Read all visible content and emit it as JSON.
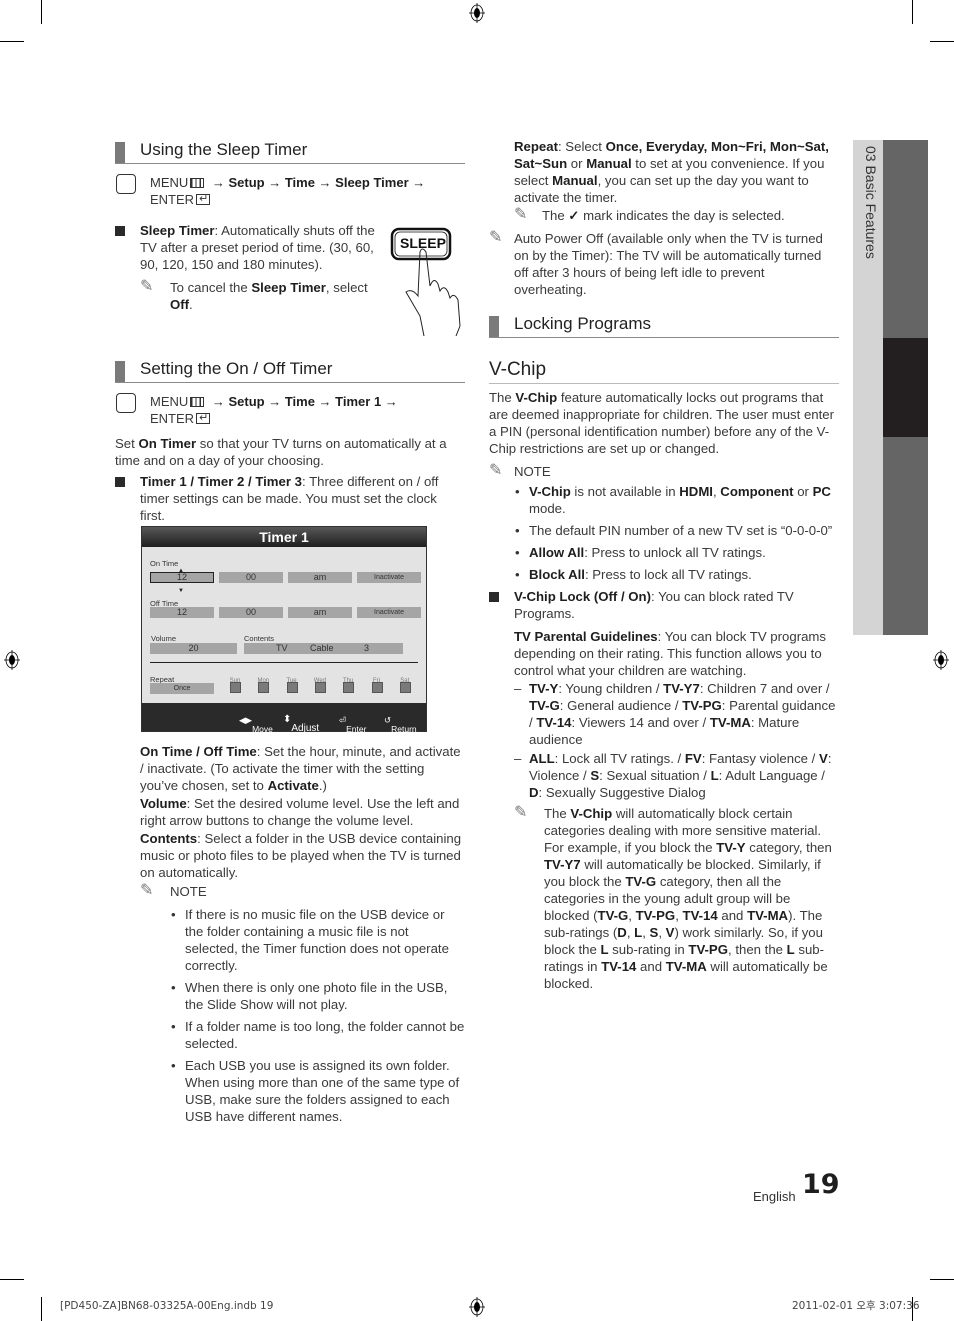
{
  "left": {
    "sleep_section": {
      "title": "Using the Sleep Timer",
      "menu_path": {
        "menu": "MENU",
        "p1": " → Setup → Time → Sleep Timer →",
        "enter": "ENTER"
      },
      "bullet_term": "Sleep Timer",
      "bullet_text": ": Automatically shuts off the TV after a preset period of time. (30, 60, 90, 120, 150 and 180 minutes).",
      "note_a": "To cancel the ",
      "note_term": "Sleep Timer",
      "note_b": ", select ",
      "note_off": "Off",
      "note_c": ".",
      "sleep_button_label": "SLEEP"
    },
    "timer_section": {
      "title": "Setting the On / Off Timer",
      "menu_path": {
        "menu": "MENU",
        "p1": " → Setup → Time → Timer 1 →",
        "enter": "ENTER"
      },
      "intro_a": "Set ",
      "intro_term": "On Timer",
      "intro_b": " so that your TV turns on automatically at a time and on a day of your choosing.",
      "bullet_term": "Timer 1 / Timer 2 / Timer 3",
      "bullet_text": ": Three different on / off timer settings can be made. You must set the clock first.",
      "osd": {
        "title": "Timer 1",
        "on_time_label": "On Time",
        "on_time": {
          "hour": "12",
          "minute": "00",
          "ampm": "am",
          "state": "Inactivate"
        },
        "off_time_label": "Off Time",
        "off_time": {
          "hour": "12",
          "minute": "00",
          "ampm": "am",
          "state": "Inactivate"
        },
        "volume_label": "Volume",
        "volume": "20",
        "contents_label": "Contents",
        "contents": {
          "source": "TV",
          "type": "Cable",
          "channel": "3"
        },
        "repeat_label": "Repeat",
        "repeat": "Once",
        "days": [
          "Sun",
          "Mon",
          "Tue",
          "Wed",
          "Thu",
          "Fri",
          "Sat"
        ],
        "footer": {
          "move": "Move",
          "adjust": "Adjust",
          "enter": "Enter",
          "return": "Return"
        }
      },
      "desc1_term": "On Time / Off Time",
      "desc1_a": ": Set the hour, minute, and activate / inactivate. (To activate the timer with the setting you’ve chosen, set to ",
      "desc1_term2": "Activate",
      "desc1_b": ".)",
      "desc2_term": "Volume",
      "desc2_text": ": Set the desired volume level. Use the left and right arrow buttons to change the volume level.",
      "desc3_term": "Contents",
      "desc3_text": ": Select a folder in the USB device containing music or photo files to be played when the TV is turned on automatically.",
      "note_label": "NOTE",
      "notes": [
        "If there is no music file on the USB device or the folder containing a music file is not selected, the Timer function does not operate correctly.",
        "When there is only one photo file in the USB, the Slide Show will not play.",
        "If a folder name is too long, the folder cannot be selected.",
        "Each USB you use is assigned its own folder. When using more than one of the same type of USB, make sure the folders assigned to each USB have different names."
      ]
    }
  },
  "right": {
    "repeat_term": "Repeat",
    "repeat_a": ": Select ",
    "repeat_opts": "Once, Everyday, Mon~Fri, Mon~Sat, Sat~Sun",
    "repeat_b": " or ",
    "repeat_manual": "Manual",
    "repeat_c": " to set at you convenience. If you select ",
    "repeat_manual2": "Manual",
    "repeat_d": ", you can set up the day you want to activate the timer.",
    "check_note_a": "The ",
    "check_note_b": " mark indicates the day is selected.",
    "auto_power_note": "Auto Power Off (available only when the TV is turned on by the Timer): The TV will be automatically turned off after 3 hours of being left idle to prevent overheating.",
    "locking_title": "Locking Programs",
    "vchip_title": "V-Chip",
    "vchip_intro_a": "The ",
    "vchip_intro_term": "V-Chip",
    "vchip_intro_b": " feature automatically locks out programs that are deemed inappropriate for children. The user must enter a PIN (personal identification number) before any of the V-Chip restrictions are set up or changed.",
    "note_label": "NOTE",
    "notes": [
      {
        "t1": "V-Chip",
        "a": " is not available in ",
        "t2": "HDMI",
        "b": ", ",
        "t3": "Component",
        "c": " or ",
        "t4": "PC",
        "d": " mode."
      },
      {
        "text": "The default PIN number of a new TV set is “0-0-0-0”"
      },
      {
        "term": "Allow All",
        "text": ": Press to unlock all TV ratings."
      },
      {
        "term": "Block All",
        "text": ": Press to lock all TV ratings."
      }
    ],
    "lock_term": "V-Chip Lock (Off / On)",
    "lock_text": ": You can block rated TV Programs.",
    "guide_term": "TV Parental Guidelines",
    "guide_text": ": You can block TV programs depending on their rating. This function allows you to control what your children are watching.",
    "ratings1": [
      {
        "term": "TV-Y",
        "text": ": Young children / "
      },
      {
        "term": "TV-Y7",
        "text": ": Children 7 and over / "
      },
      {
        "term": "TV-G",
        "text": ": General audience / "
      },
      {
        "term": "TV-PG",
        "text": ": Parental guidance / "
      },
      {
        "term": "TV-14",
        "text": ": Viewers 14 and over / "
      },
      {
        "term": "TV-MA",
        "text": ": Mature audience"
      }
    ],
    "ratings2": [
      {
        "term": "ALL",
        "text": ": Lock all TV ratings. / "
      },
      {
        "term": "FV",
        "text": ": Fantasy violence / "
      },
      {
        "term": "V",
        "text": ": Violence / "
      },
      {
        "term": "S",
        "text": ": Sexual situation / "
      },
      {
        "term": "L",
        "text": ": Adult Language / "
      },
      {
        "term": "D",
        "text": ": Sexually Suggestive Dialog"
      }
    ],
    "final_note_html_parts": [
      [
        "The ",
        ""
      ],
      [
        "V-Chip",
        "b"
      ],
      [
        " will automatically block certain categories dealing with more sensitive material. For example, if you block the ",
        ""
      ],
      [
        "TV-Y",
        "b"
      ],
      [
        " category, then ",
        ""
      ],
      [
        "TV-Y7",
        "b"
      ],
      [
        " will automatically be blocked. Similarly, if you block the ",
        ""
      ],
      [
        "TV-G",
        "b"
      ],
      [
        " category, then all the categories in the young adult group will be blocked (",
        ""
      ],
      [
        "TV-G",
        "b"
      ],
      [
        ", ",
        ""
      ],
      [
        "TV-PG",
        "b"
      ],
      [
        ", ",
        ""
      ],
      [
        "TV-14",
        "b"
      ],
      [
        " and ",
        ""
      ],
      [
        "TV-MA",
        "b"
      ],
      [
        "). The sub-ratings (",
        ""
      ],
      [
        "D",
        "b"
      ],
      [
        ", ",
        ""
      ],
      [
        "L",
        "b"
      ],
      [
        ", ",
        ""
      ],
      [
        "S",
        "b"
      ],
      [
        ", ",
        ""
      ],
      [
        "V",
        "b"
      ],
      [
        ") work similarly. So, if you block the ",
        ""
      ],
      [
        "L",
        "b"
      ],
      [
        " sub-rating in ",
        ""
      ],
      [
        "TV-PG",
        "b"
      ],
      [
        ", then the ",
        ""
      ],
      [
        "L",
        "b"
      ],
      [
        " sub-ratings in ",
        ""
      ],
      [
        "TV-14",
        "b"
      ],
      [
        " and ",
        ""
      ],
      [
        "TV-MA",
        "b"
      ],
      [
        " will automatically be blocked.",
        ""
      ]
    ]
  },
  "side_tab": {
    "label": "03   Basic Features"
  },
  "footer": {
    "language": "English",
    "page_number": "19"
  },
  "slug": {
    "left": "[PD450-ZA]BN68-03325A-00Eng.indb   19",
    "right": "2011-02-01   오후 3:07:36"
  }
}
